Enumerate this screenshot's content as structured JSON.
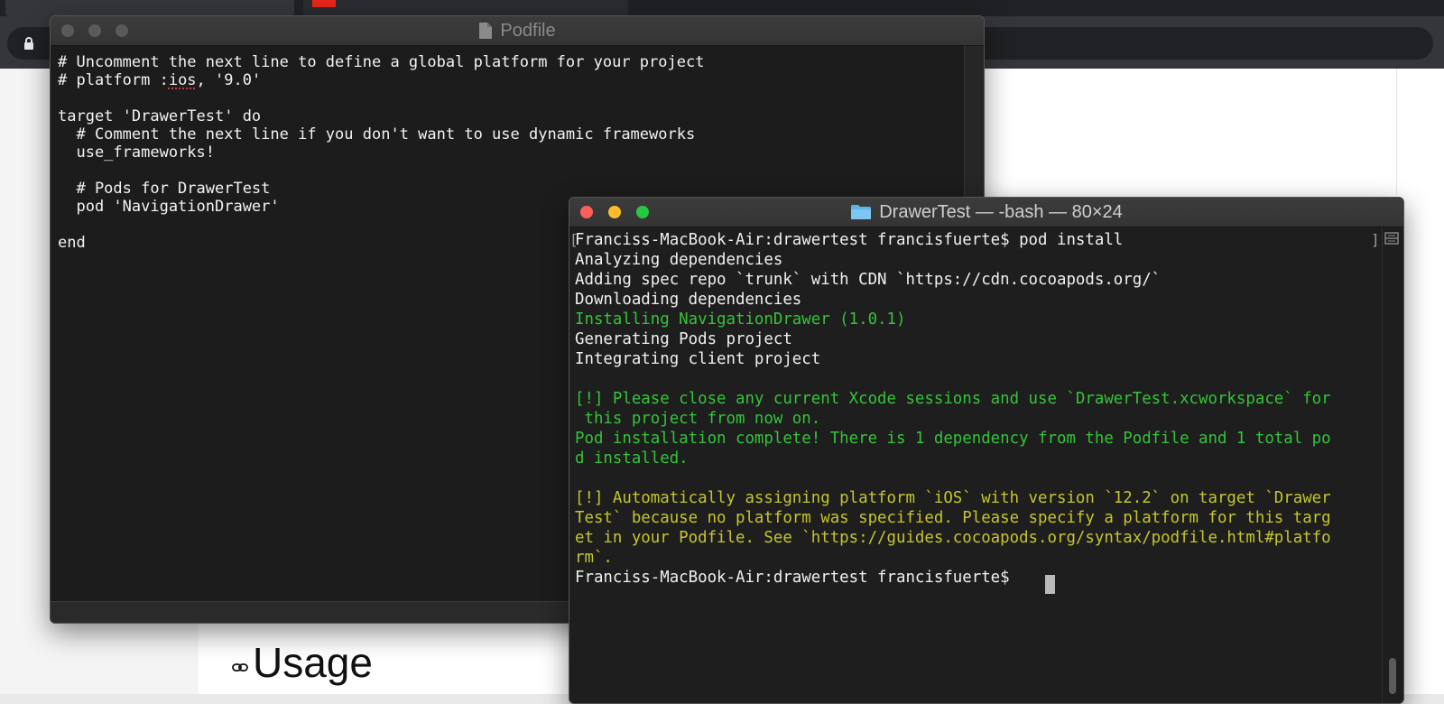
{
  "browser": {
    "accent_tab_icon_color": "#e8261a"
  },
  "web": {
    "heading": "Usage",
    "link_icon": "link-icon"
  },
  "podfile_window": {
    "title": "Podfile",
    "icon": "document-icon",
    "lines": [
      "# Uncomment the next line to define a global platform for your project",
      "# platform :ios, '9.0'",
      "",
      "target 'DrawerTest' do",
      "  # Comment the next line if you don't want to use dynamic frameworks",
      "  use_frameworks!",
      "",
      "  # Pods for DrawerTest",
      "  pod 'NavigationDrawer'",
      "",
      "end"
    ]
  },
  "terminal_window": {
    "title": "DrawerTest — -bash — 80×24",
    "icon": "folder-icon",
    "colors": {
      "default": "#f0f0f0",
      "success": "#35c33a",
      "warning": "#c6c52e"
    },
    "lines": [
      {
        "text": "Franciss-MacBook-Air:drawertest francisfuerte$ pod install",
        "color": "default"
      },
      {
        "text": "Analyzing dependencies",
        "color": "default"
      },
      {
        "text": "Adding spec repo `trunk` with CDN `https://cdn.cocoapods.org/`",
        "color": "default"
      },
      {
        "text": "Downloading dependencies",
        "color": "default"
      },
      {
        "text": "Installing NavigationDrawer (1.0.1)",
        "color": "success"
      },
      {
        "text": "Generating Pods project",
        "color": "default"
      },
      {
        "text": "Integrating client project",
        "color": "default"
      },
      {
        "text": "",
        "color": "default"
      },
      {
        "text": "[!] Please close any current Xcode sessions and use `DrawerTest.xcworkspace` for",
        "color": "success"
      },
      {
        "text": " this project from now on.",
        "color": "success"
      },
      {
        "text": "Pod installation complete! There is 1 dependency from the Podfile and 1 total po",
        "color": "success"
      },
      {
        "text": "d installed.",
        "color": "success"
      },
      {
        "text": "",
        "color": "default"
      },
      {
        "text": "[!] Automatically assigning platform `iOS` with version `12.2` on target `Drawer",
        "color": "warning"
      },
      {
        "text": "Test` because no platform was specified. Please specify a platform for this targ",
        "color": "warning"
      },
      {
        "text": "et in your Podfile. See `https://guides.cocoapods.org/syntax/podfile.html#platfo",
        "color": "warning"
      },
      {
        "text": "rm`.",
        "color": "warning"
      },
      {
        "text": "Franciss-MacBook-Air:drawertest francisfuerte$ ",
        "color": "default"
      }
    ]
  }
}
